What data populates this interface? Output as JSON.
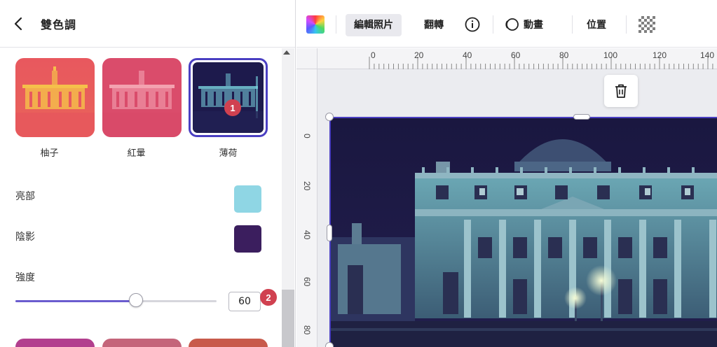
{
  "panel": {
    "title": "雙色調",
    "back_icon": "chevron-left-icon"
  },
  "presets": [
    {
      "label": "柚子",
      "colors": [
        "#e8555f",
        "#f5b83f"
      ]
    },
    {
      "label": "紅暈",
      "colors": [
        "#d94a6a",
        "#f09aa8"
      ]
    },
    {
      "label": "薄荷",
      "colors": [
        "#1b1845",
        "#7dd8e3"
      ],
      "selected": true
    }
  ],
  "badges": {
    "first": "1",
    "second": "2"
  },
  "highlight": {
    "label": "亮部",
    "color": "#8fd6e4"
  },
  "shadow": {
    "label": "陰影",
    "color": "#3b1e5e"
  },
  "intensity": {
    "label": "強度",
    "value": "60",
    "fraction": 0.6
  },
  "toolbar": {
    "edit_photo": "編輯照片",
    "flip": "翻轉",
    "info_icon": "info-icon",
    "animate": "動畫",
    "position": "位置",
    "transparency_icon": "transparency-icon"
  },
  "ruler": {
    "top_ticks": [
      "0",
      "20",
      "40",
      "60",
      "80",
      "100",
      "120",
      "140"
    ],
    "left_ticks": [
      "0",
      "20",
      "40",
      "60",
      "80"
    ]
  },
  "canvas": {
    "trash_icon": "trash-icon"
  },
  "colors": {
    "accent": "#4a3fc2",
    "badge": "#d04150"
  }
}
